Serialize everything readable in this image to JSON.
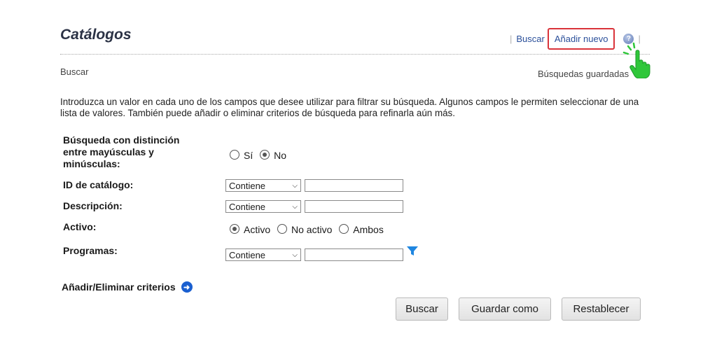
{
  "header": {
    "title": "Catálogos",
    "links": {
      "search": "Buscar",
      "add_new": "Añadir nuevo"
    },
    "help_icon": "question-circle-icon"
  },
  "subheader": {
    "left": "Buscar",
    "saved_searches": "Búsquedas guardadas"
  },
  "intro_text": "Introduzca un valor en cada uno de los campos que desee utilizar para filtrar su búsqueda. Algunos campos le permiten seleccionar de una lista de valores. También puede añadir o eliminar criterios de búsqueda para refinarla aún más.",
  "form": {
    "case_sensitive": {
      "label": "Búsqueda con distinción entre mayúsculas y minúsculas:",
      "options": [
        "Sí",
        "No"
      ],
      "selected": "No"
    },
    "catalog_id": {
      "label": "ID de catálogo:",
      "operator": "Contiene",
      "value": ""
    },
    "description": {
      "label": "Descripción:",
      "operator": "Contiene",
      "value": ""
    },
    "active": {
      "label": "Activo:",
      "options": [
        "Activo",
        "No activo",
        "Ambos"
      ],
      "selected": "Activo"
    },
    "programs": {
      "label": "Programas:",
      "operator": "Contiene",
      "value": ""
    }
  },
  "add_remove_criteria": "Añadir/Eliminar criterios",
  "buttons": {
    "search": "Buscar",
    "save_as": "Guardar como",
    "reset": "Restablecer"
  },
  "colors": {
    "link": "#2a4f9a",
    "highlight_border": "#d9333a",
    "filter_icon": "#1f86e0",
    "pointer_hand": "#2fc73a"
  }
}
